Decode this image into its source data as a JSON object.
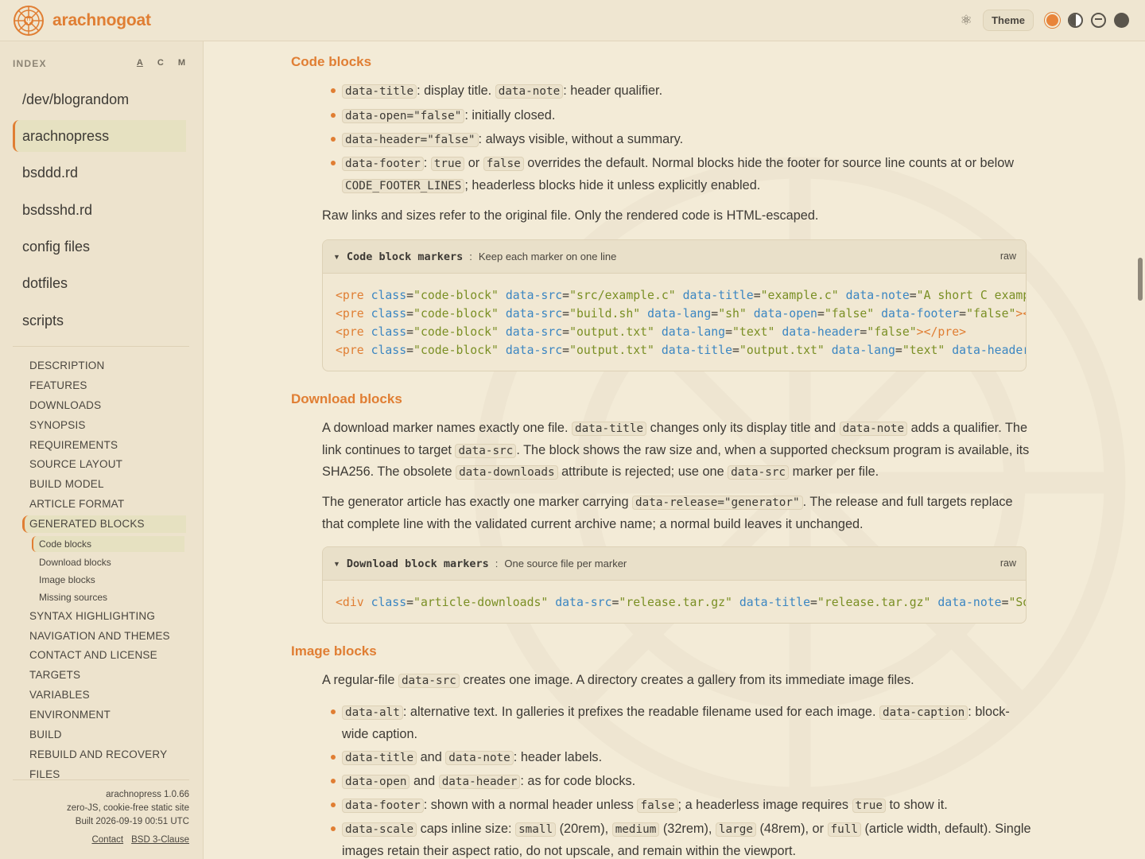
{
  "header": {
    "brand": "arachnogoat",
    "theme_label": "Theme",
    "icons": [
      "atom-icon",
      "swatch-orange",
      "swatch-contrast",
      "swatch-outline",
      "swatch-dark"
    ]
  },
  "sidebar": {
    "index_heading": "INDEX",
    "sort": [
      "A",
      "C",
      "M"
    ],
    "pages": [
      "/dev/blograndom",
      "arachnopress",
      "bsddd.rd",
      "bsdsshd.rd",
      "config files",
      "dotfiles",
      "scripts"
    ],
    "active_page": "arachnopress",
    "toc": [
      "DESCRIPTION",
      "FEATURES",
      "DOWNLOADS",
      "SYNOPSIS",
      "REQUIREMENTS",
      "SOURCE LAYOUT",
      "BUILD MODEL",
      "ARTICLE FORMAT",
      "GENERATED BLOCKS",
      "SYNTAX HIGHLIGHTING",
      "NAVIGATION AND THEMES",
      "CONTACT AND LICENSE",
      "TARGETS",
      "VARIABLES",
      "ENVIRONMENT",
      "BUILD",
      "REBUILD AND RECOVERY",
      "FILES"
    ],
    "toc_sub": [
      "Code blocks",
      "Download blocks",
      "Image blocks",
      "Missing sources"
    ],
    "footer": {
      "version": "arachnopress 1.0.66",
      "tagline": "zero-JS, cookie-free static site",
      "built": "Built 2026-09-19 00:51 UTC",
      "contact": "Contact",
      "license": "BSD 3-Clause"
    }
  },
  "content": {
    "code_blocks": {
      "heading": "Code blocks",
      "raw_note": "Raw links and sizes refer to the original file. Only the rendered code is HTML-escaped.",
      "box_title": "Code block markers",
      "box_note": "Keep each marker on one line",
      "raw_label": "raw"
    },
    "download_blocks": {
      "heading": "Download blocks",
      "box_title": "Download block markers",
      "box_note": "One source file per marker",
      "raw_label": "raw"
    },
    "image_blocks": {
      "heading": "Image blocks"
    }
  }
}
